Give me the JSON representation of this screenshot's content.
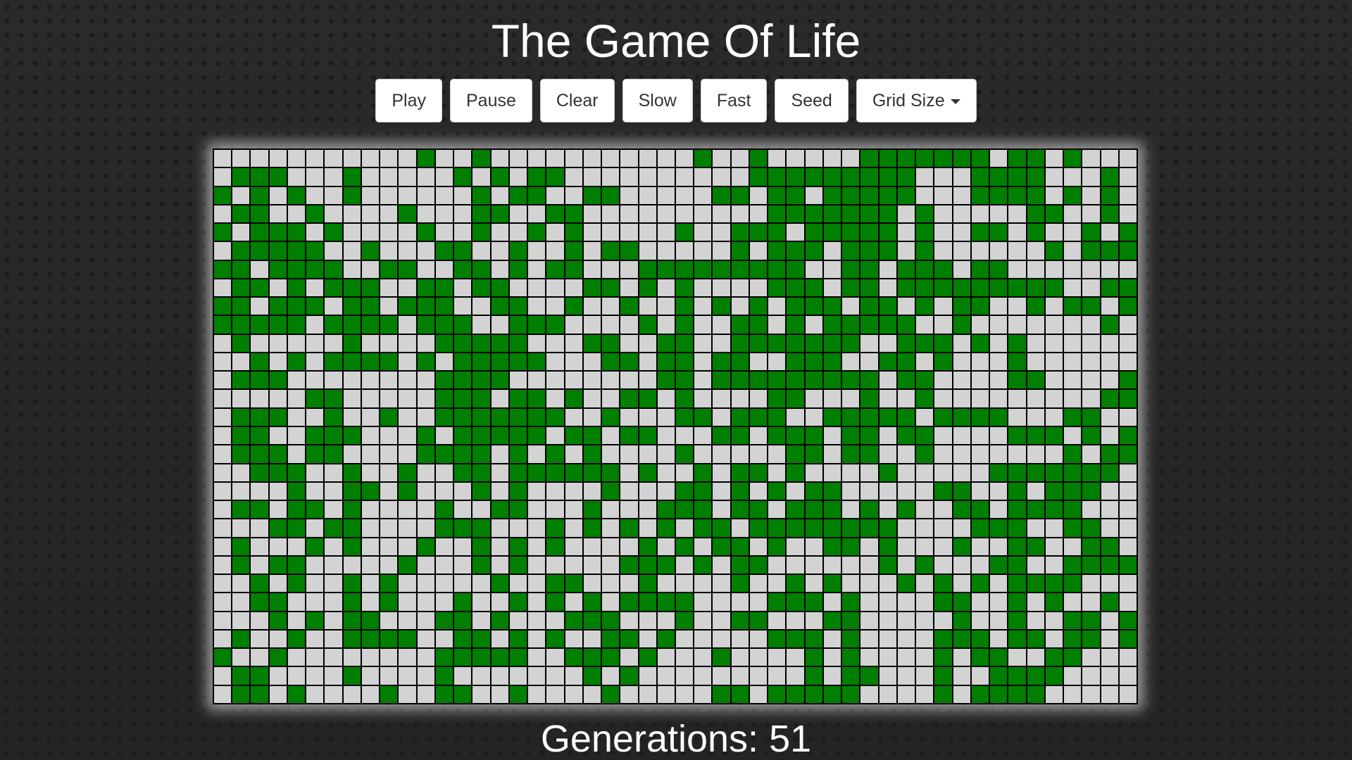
{
  "title": "The Game Of Life",
  "toolbar": {
    "play_label": "Play",
    "pause_label": "Pause",
    "clear_label": "Clear",
    "slow_label": "Slow",
    "fast_label": "Fast",
    "seed_label": "Seed",
    "grid_size_label": "Grid Size"
  },
  "grid": {
    "columns": 50,
    "rows": 30,
    "alive_color": "#007f00",
    "dead_color": "#d3d3d3",
    "cells": [
      "00000000000100100000000000100100000111111101101000",
      "01110001000001010110000000000111111111000111100010",
      "10101001000000101100110000011011011111000111101010",
      "01100100001000110011000000000011111110100000110010",
      "10111010000100100101000001001110111110100110100101",
      "01111100100011001001011000001011101110100000010111",
      "11011110011001101011000111111111001101110110000000",
      "01101011100110110000110101000011101101111111110011",
      "11011101101110011001001001010101110110101100101101",
      "11111011110111001110000101001101011111001000000010",
      "01000001000011111000110011001111111001110101000000",
      "00101011110101111100011011011001110011010001000000",
      "01110000000011110000000011011111111101100001100001",
      "00000110000011101101001101000011000100100000000011",
      "01110010010011111110010001101110011111011110001100",
      "01100111000101111101101100011011101101100001110101",
      "01110110000111101010100001000001101100100000001011",
      "00111001001001101111110100101101000010000011111110",
      "00001001101000101000010001101010110000011001011100",
      "01101101000010011000100011101101110101001101111000",
      "00011011000011100010101010110111111110000111001100",
      "01000101000100101010000101011010011010001001100110",
      "01011000001000101000001110101100000010100011001111",
      "00101001010000010011000100001001010001010101111000",
      "00110001010001001010101111000011101000011001010010",
      "00010101100011010001110001001100011000001001001101",
      "01001001111001101010011010000011101000011101101101",
      "10010000000011111001110100010000101000010110011000",
      "01100001000010000000101000000000101100010011110000",
      "01101000010011001000010000011011111000010111100000"
    ]
  },
  "generations_label": "Generations:",
  "generations_count": "51"
}
